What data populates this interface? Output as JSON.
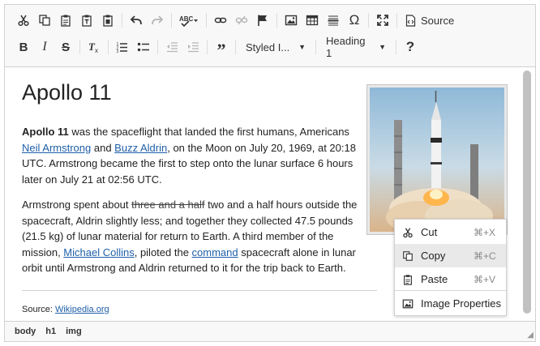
{
  "toolbar": {
    "source_label": "Source",
    "styles_combo": "Styled I...",
    "format_combo": "Heading 1",
    "help_symbol": "?"
  },
  "content": {
    "title": "Apollo 11",
    "p1": [
      {
        "t": "Apollo 11",
        "b": true
      },
      {
        "t": " was the spaceflight that landed the first humans, Americans "
      },
      {
        "t": "Neil Armstrong",
        "link": true
      },
      {
        "t": " and "
      },
      {
        "t": "Buzz Aldrin",
        "link": true
      },
      {
        "t": ", on the Moon on July 20, 1969, at 20:18 UTC. Armstrong became the first to step onto the lunar surface 6 hours later on July 21 at 02:56 UTC."
      }
    ],
    "p2": [
      {
        "t": "Armstrong spent about "
      },
      {
        "t": "three and a half",
        "strike": true
      },
      {
        "t": " two and a half hours outside the spacecraft, Aldrin slightly less; and together they collected 47.5 pounds (21.5 kg) of lunar material for return to Earth. A third member of the mission, "
      },
      {
        "t": "Michael Collins",
        "link": true
      },
      {
        "t": ", piloted the "
      },
      {
        "t": "command",
        "link": true
      },
      {
        "t": " spacecraft alone in lunar orbit until Armstrong and Aldrin returned to it for the trip back to Earth."
      }
    ],
    "source_prefix": "Source: ",
    "source_link": "Wikipedia.org"
  },
  "statusbar": {
    "path": [
      "body",
      "h1",
      "img"
    ]
  },
  "context_menu": {
    "items": [
      {
        "label": "Cut",
        "shortcut": "⌘+X",
        "icon": "cut-icon"
      },
      {
        "label": "Copy",
        "shortcut": "⌘+C",
        "icon": "copy-icon"
      },
      {
        "label": "Paste",
        "shortcut": "⌘+V",
        "icon": "paste-icon"
      },
      {
        "label": "Image Properties",
        "shortcut": "",
        "icon": "image-icon"
      }
    ],
    "selected": "Copy"
  },
  "colors": {
    "link": "#1f5fa8",
    "toolbar_bg": "#f8f8f8",
    "border": "#d1d1d1",
    "selected_bg": "#e9e9e9"
  }
}
